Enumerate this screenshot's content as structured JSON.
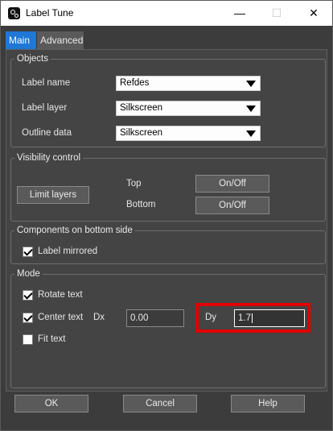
{
  "window": {
    "title": "Label Tune",
    "minimize": "—",
    "maximize": "☐",
    "close": "✕"
  },
  "tabs": [
    {
      "label": "Main"
    },
    {
      "label": "Advanced"
    }
  ],
  "objects": {
    "legend": "Objects",
    "label_name": {
      "label": "Label name",
      "value": "Refdes"
    },
    "label_layer": {
      "label": "Label layer",
      "value": "Silkscreen"
    },
    "outline_data": {
      "label": "Outline data",
      "value": "Silkscreen"
    }
  },
  "visibility": {
    "legend": "Visibility control",
    "limit_layers": "Limit layers",
    "top_label": "Top",
    "top_button": "On/Off",
    "bottom_label": "Bottom",
    "bottom_button": "On/Off"
  },
  "bottom_side": {
    "legend": "Components on bottom side",
    "label_mirrored": {
      "label": "Label mirrored",
      "checked": true
    }
  },
  "mode": {
    "legend": "Mode",
    "rotate_text": {
      "label": "Rotate text",
      "checked": true
    },
    "center_text": {
      "label": "Center text",
      "checked": true
    },
    "dx_label": "Dx",
    "dx_value": "0.00",
    "dy_label": "Dy",
    "dy_value": "1.7",
    "fit_text": {
      "label": "Fit text",
      "checked": false
    }
  },
  "footer": {
    "ok": "OK",
    "cancel": "Cancel",
    "help": "Help"
  },
  "colors": {
    "accent": "#1f77d6",
    "highlight": "#e00000"
  }
}
